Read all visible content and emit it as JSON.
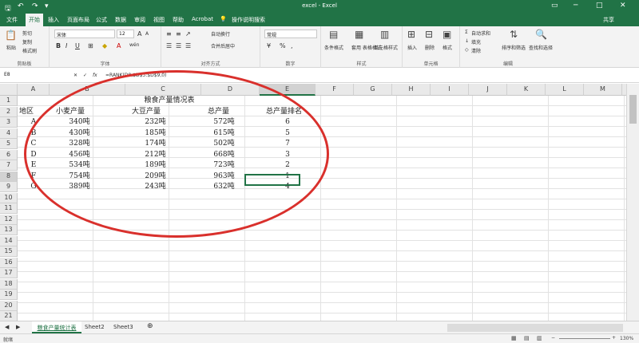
{
  "app": {
    "window_title": "excel - Excel",
    "share_label": "共享",
    "tell_me": "操作说明搜索"
  },
  "ribbon_tabs": [
    "文件",
    "开始",
    "插入",
    "页面布局",
    "公式",
    "数据",
    "审阅",
    "视图",
    "帮助",
    "Acrobat"
  ],
  "ribbon": {
    "clipboard": {
      "paste": "粘贴",
      "cut": "剪切",
      "copy": "复制",
      "format_painter": "格式刷",
      "label": "剪贴板"
    },
    "font": {
      "name": "宋体",
      "size": "12",
      "bold": "B",
      "italic": "I",
      "underline": "U",
      "label": "字体",
      "grow": "A",
      "shrink": "A",
      "color_a": "A",
      "wen": "wén"
    },
    "alignment": {
      "wrap": "自动换行",
      "merge": "合并后居中",
      "label": "对齐方式"
    },
    "number": {
      "format": "常规",
      "percent": "%",
      "comma": ",",
      "label": "数字"
    },
    "styles": {
      "conditional": "条件格式",
      "table": "套用\n表格格式",
      "cell_styles": "单元格样式",
      "label": "样式"
    },
    "cells": {
      "insert": "插入",
      "delete": "删除",
      "format": "格式",
      "label": "单元格"
    },
    "editing": {
      "autosum": "自动求和",
      "fill": "填充",
      "clear": "清除",
      "sort": "排序和筛选",
      "find": "查找和选择",
      "label": "编辑"
    }
  },
  "formula_bar": {
    "name_box": "E8",
    "fx": "fx",
    "formula": "=RANK(D8,$D$3:$D$9,0)"
  },
  "columns": [
    "A",
    "B",
    "C",
    "D",
    "E",
    "F",
    "G",
    "H",
    "I",
    "J",
    "K",
    "L",
    "M",
    "N"
  ],
  "rows": [
    "1",
    "2",
    "3",
    "4",
    "5",
    "6",
    "7",
    "8",
    "9",
    "10",
    "11",
    "12",
    "13",
    "14",
    "15",
    "16",
    "17",
    "18",
    "19",
    "20",
    "21"
  ],
  "sheet": {
    "title": "粮食产量情况表",
    "headers": [
      "地区",
      "小麦产量",
      "大豆产量",
      "总产量",
      "总产量排名"
    ],
    "data": [
      [
        "A",
        "340吨",
        "232吨",
        "572吨",
        "6"
      ],
      [
        "B",
        "430吨",
        "185吨",
        "615吨",
        "5"
      ],
      [
        "C",
        "328吨",
        "174吨",
        "502吨",
        "7"
      ],
      [
        "D",
        "456吨",
        "212吨",
        "668吨",
        "3"
      ],
      [
        "E",
        "534吨",
        "189吨",
        "723吨",
        "2"
      ],
      [
        "F",
        "754吨",
        "209吨",
        "963吨",
        "1"
      ],
      [
        "G",
        "389吨",
        "243吨",
        "632吨",
        "4"
      ]
    ]
  },
  "sheet_tabs": [
    "粮食产量统计表",
    "Sheet2",
    "Sheet3"
  ],
  "status": {
    "ready": "就绪",
    "zoom": "130%"
  },
  "colors": {
    "accent": "#217346",
    "annotation": "#d9302c"
  }
}
